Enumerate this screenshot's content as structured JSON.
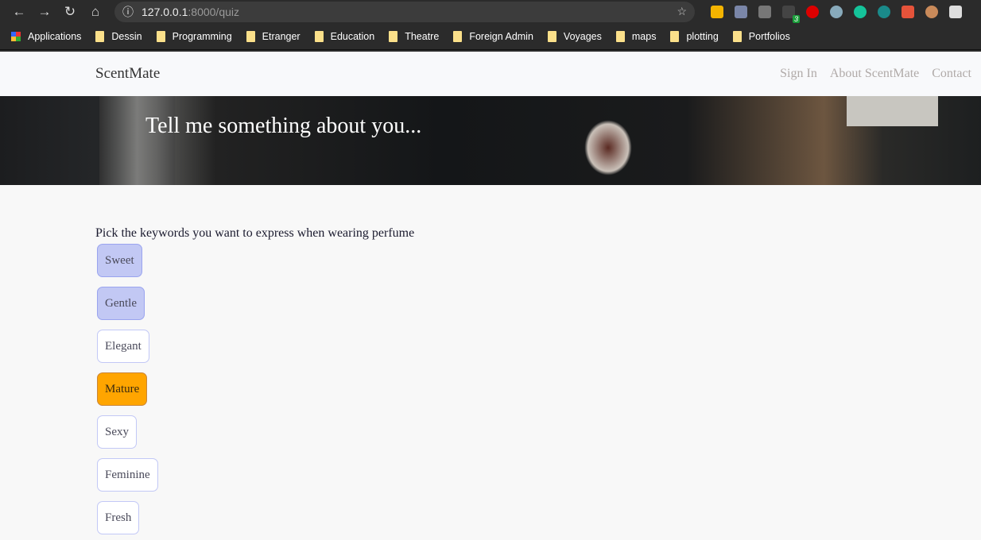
{
  "browser": {
    "url_host": "127.0.0.1",
    "url_path": ":8000/quiz",
    "extension_badge": "3",
    "bookmarks": [
      "Applications",
      "Dessin",
      "Programming",
      "Etranger",
      "Education",
      "Theatre",
      "Foreign Admin",
      "Voyages",
      "maps",
      "plotting",
      "Portfolios"
    ]
  },
  "nav": {
    "brand": "ScentMate",
    "links": [
      "Sign In",
      "About ScentMate",
      "Contact"
    ]
  },
  "hero": {
    "title": "Tell me something about you..."
  },
  "quiz": {
    "prompt": "Pick the keywords you want to express when wearing perfume",
    "keywords": [
      {
        "label": "Sweet",
        "state": "selected"
      },
      {
        "label": "Gentle",
        "state": "selected"
      },
      {
        "label": "Elegant",
        "state": "default"
      },
      {
        "label": "Mature",
        "state": "highlighted"
      },
      {
        "label": "Sexy",
        "state": "default"
      },
      {
        "label": "Feminine",
        "state": "default"
      },
      {
        "label": "Fresh",
        "state": "default"
      }
    ]
  },
  "colors": {
    "selected": "#c2c8f4",
    "highlighted": "#ffa500",
    "border": "#c2c8f6"
  }
}
